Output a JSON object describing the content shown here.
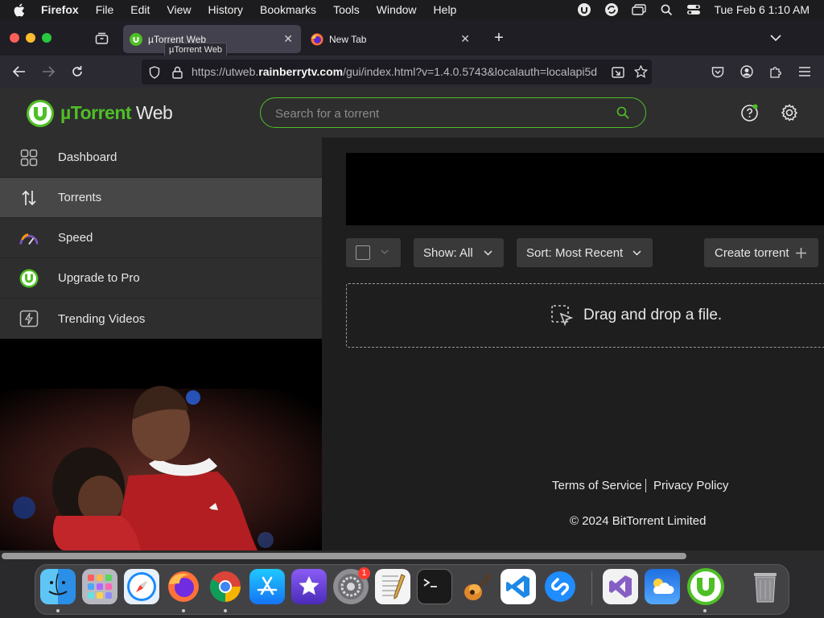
{
  "menubar": {
    "app": "Firefox",
    "items": [
      "File",
      "Edit",
      "View",
      "History",
      "Bookmarks",
      "Tools",
      "Window",
      "Help"
    ],
    "clock": "Tue Feb 6  1:10 AM"
  },
  "tabs": [
    {
      "label": "µTorrent Web",
      "active": true
    },
    {
      "label": "New Tab",
      "active": false
    }
  ],
  "tooltip": "µTorrent Web",
  "url": {
    "prefix": "https://utweb.",
    "domain": "rainberrytv.com",
    "path": "/gui/index.html?v=1.4.0.5743&localauth=localapi5d"
  },
  "app": {
    "logo_mu": "µTorrent",
    "logo_web": " Web",
    "search_placeholder": "Search for a torrent"
  },
  "sidebar": {
    "items": [
      {
        "label": "Dashboard",
        "icon": "dashboard-icon"
      },
      {
        "label": "Torrents",
        "icon": "up-down-arrows-icon",
        "active": true
      },
      {
        "label": "Speed",
        "icon": "speedometer-icon"
      },
      {
        "label": "Upgrade to Pro",
        "icon": "utorrent-logo-icon"
      },
      {
        "label": "Trending Videos",
        "icon": "lightning-video-icon"
      }
    ]
  },
  "toolbar": {
    "show_label": "Show:",
    "show_value": "All",
    "sort_label": "Sort:",
    "sort_value": "Most Recent",
    "create_label": "Create torrent"
  },
  "dropzone": {
    "label": "Drag and drop a file."
  },
  "footer": {
    "terms": "Terms of Service",
    "privacy": "Privacy Policy",
    "copyright": "© 2024 BitTorrent Limited"
  },
  "dock": {
    "apps": [
      "Finder",
      "Launchpad",
      "Safari",
      "Firefox",
      "Chrome",
      "App Store",
      "iMovie",
      "System Settings",
      "TextEdit",
      "Terminal",
      "GarageBand",
      "VS Code",
      "Shazam",
      "Visual Studio",
      "Weather",
      "uTorrent Web",
      "Trash"
    ],
    "badge": "1"
  },
  "colors": {
    "accent_green": "#4fbf26",
    "sidebar_bg": "#2e2e2e",
    "sidebar_active": "#474747"
  }
}
